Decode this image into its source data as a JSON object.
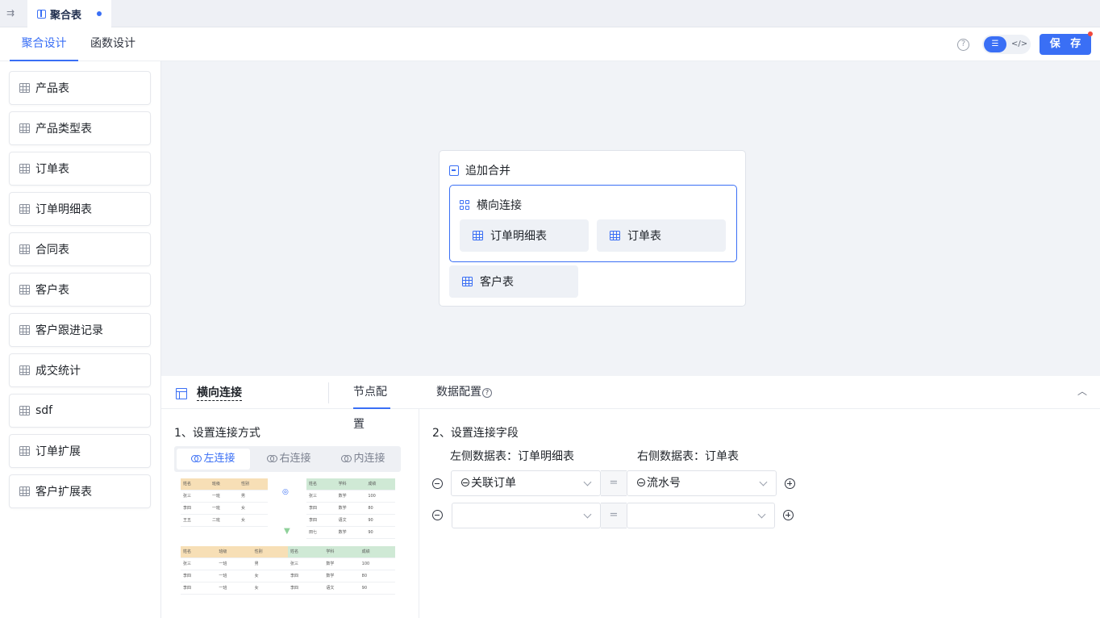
{
  "tab": {
    "title": "聚合表"
  },
  "subnav": {
    "tabs": [
      "聚合设计",
      "函数设计"
    ],
    "save_label": "保 存"
  },
  "sidebar": {
    "items": [
      "产品表",
      "产品类型表",
      "订单表",
      "订单明细表",
      "合同表",
      "客户表",
      "客户跟进记录",
      "成交统计",
      "sdf",
      "订单扩展",
      "客户扩展表"
    ]
  },
  "canvas": {
    "merge_title": "追加合并",
    "join_title": "横向连接",
    "join_nodes": [
      "订单明细表",
      "订单表"
    ],
    "extra_node": "客户表"
  },
  "bottom": {
    "node_title": "横向连接",
    "tabs": [
      "节点配置",
      "数据配置"
    ],
    "help": "?"
  },
  "left_panel": {
    "title": "1、设置连接方式",
    "join_types": [
      "左连接",
      "右连接",
      "内连接"
    ],
    "selected": "左连接",
    "illustration": {
      "left_table": {
        "headers": [
          "姓名",
          "班级",
          "性别"
        ],
        "rows": [
          [
            "张三",
            "一班",
            "男"
          ],
          [
            "李四",
            "一班",
            "女"
          ],
          [
            "王五",
            "二班",
            "女"
          ]
        ]
      },
      "right_table": {
        "headers": [
          "姓名",
          "学科",
          "成绩"
        ],
        "rows": [
          [
            "张三",
            "数学",
            "100"
          ],
          [
            "李四",
            "数学",
            "80"
          ],
          [
            "李四",
            "语文",
            "90"
          ],
          [
            "田七",
            "数学",
            "90"
          ]
        ]
      },
      "result_table": {
        "headers": [
          "姓名",
          "班级",
          "性别",
          "姓名",
          "学科",
          "成绩"
        ],
        "rows": [
          [
            "张三",
            "一班",
            "男",
            "张三",
            "数学",
            "100"
          ],
          [
            "李四",
            "一班",
            "女",
            "李四",
            "数学",
            "80"
          ],
          [
            "李四",
            "一班",
            "女",
            "李四",
            "语文",
            "90"
          ]
        ]
      }
    }
  },
  "right_panel": {
    "title": "2、设置连接字段",
    "left_label": "左侧数据表：订单明细表",
    "right_label": "右侧数据表：订单表",
    "eq": "=",
    "rows": [
      {
        "left": "关联订单",
        "right": "流水号"
      },
      {
        "left": "",
        "right": ""
      }
    ]
  }
}
